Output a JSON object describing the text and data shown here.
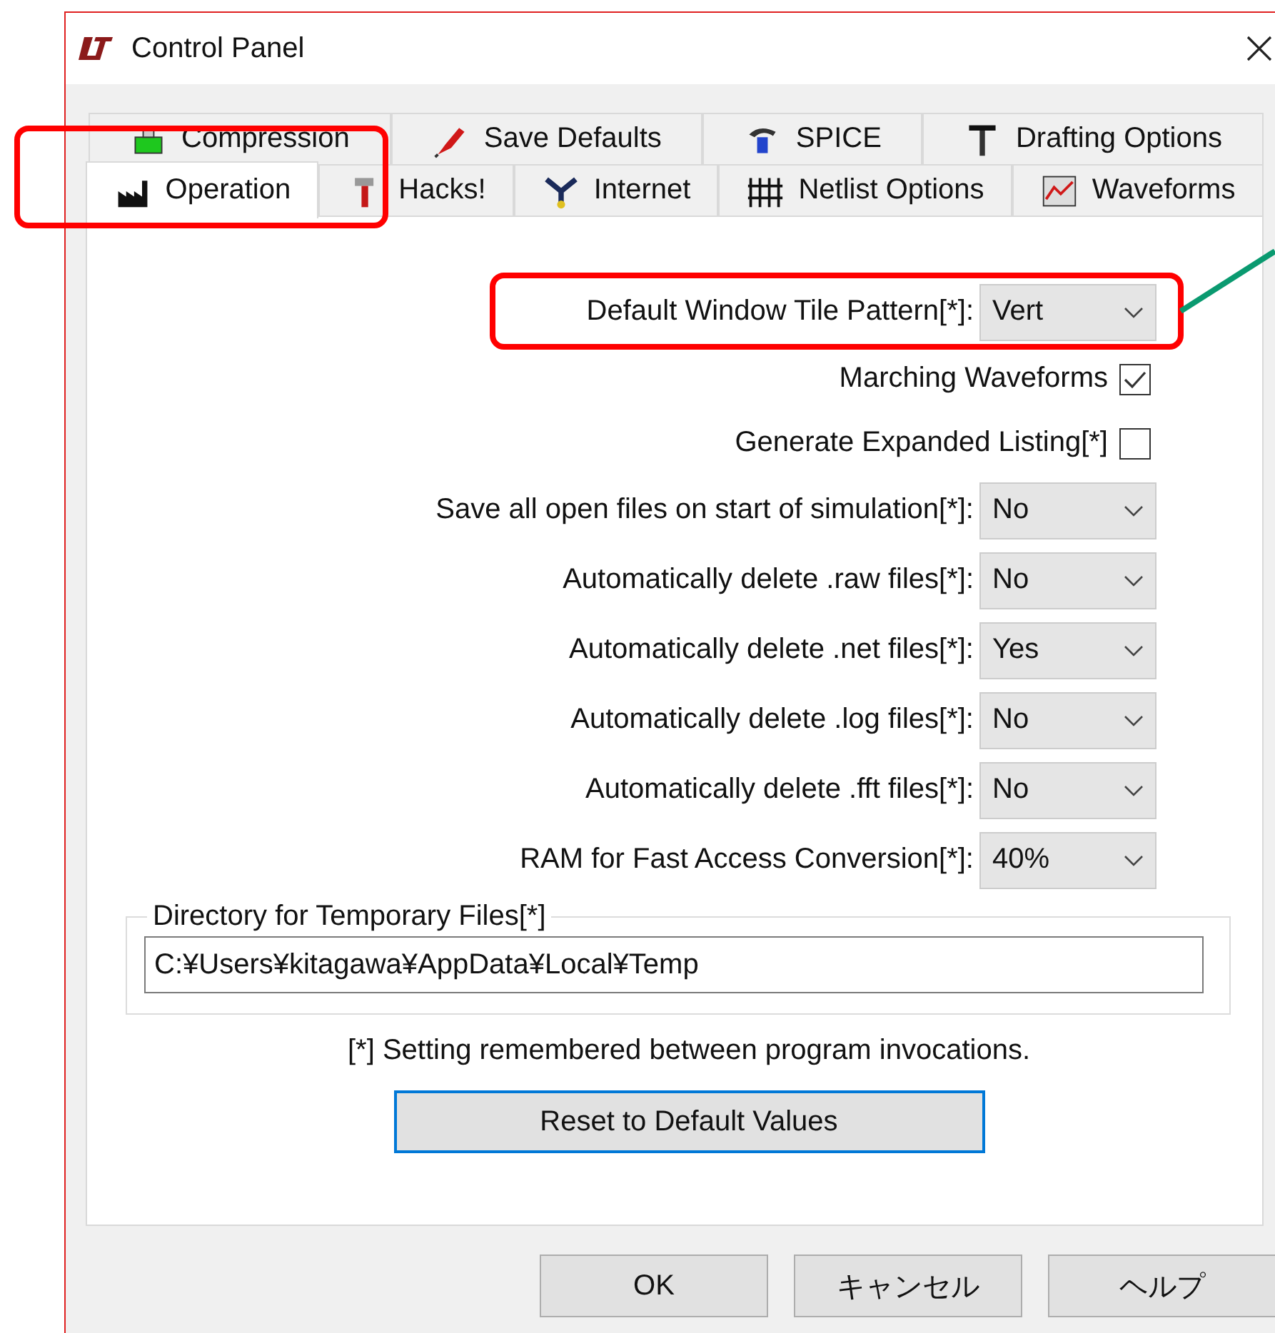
{
  "window": {
    "title": "Control Panel"
  },
  "tab_rows": [
    [
      {
        "label": "Compression",
        "selected": false
      },
      {
        "label": "Save Defaults",
        "selected": false
      },
      {
        "label": "SPICE",
        "selected": false
      },
      {
        "label": "Drafting Options",
        "selected": false
      }
    ],
    [
      {
        "label": "Operation",
        "selected": true
      },
      {
        "label": "Hacks!",
        "selected": false
      },
      {
        "label": "Internet",
        "selected": false
      },
      {
        "label": "Netlist Options",
        "selected": false
      },
      {
        "label": "Waveforms",
        "selected": false
      }
    ]
  ],
  "settings": [
    {
      "kind": "dropdown",
      "label": "Default Window Tile Pattern[*]:",
      "value": "Vert"
    },
    {
      "kind": "checkbox",
      "label": "Marching Waveforms",
      "checked": true
    },
    {
      "kind": "checkbox",
      "label": "Generate Expanded Listing[*]",
      "checked": false
    },
    {
      "kind": "dropdown",
      "label": "Save all open files on start of simulation[*]:",
      "value": "No"
    },
    {
      "kind": "dropdown",
      "label": "Automatically delete .raw files[*]:",
      "value": "No"
    },
    {
      "kind": "dropdown",
      "label": "Automatically delete .net files[*]:",
      "value": "Yes"
    },
    {
      "kind": "dropdown",
      "label": "Automatically delete .log files[*]:",
      "value": "No"
    },
    {
      "kind": "dropdown",
      "label": "Automatically delete .fft files[*]:",
      "value": "No"
    },
    {
      "kind": "dropdown",
      "label": "RAM for Fast Access Conversion[*]:",
      "value": "40%"
    }
  ],
  "temp_dir": {
    "title": "Directory for Temporary Files[*]",
    "value": "C:¥Users¥kitagawa¥AppData¥Local¥Temp"
  },
  "note": "[*] Setting remembered between program invocations.",
  "reset_button": "Reset to Default Values",
  "buttons": [
    "OK",
    "キャンセル",
    "ヘルプ"
  ]
}
